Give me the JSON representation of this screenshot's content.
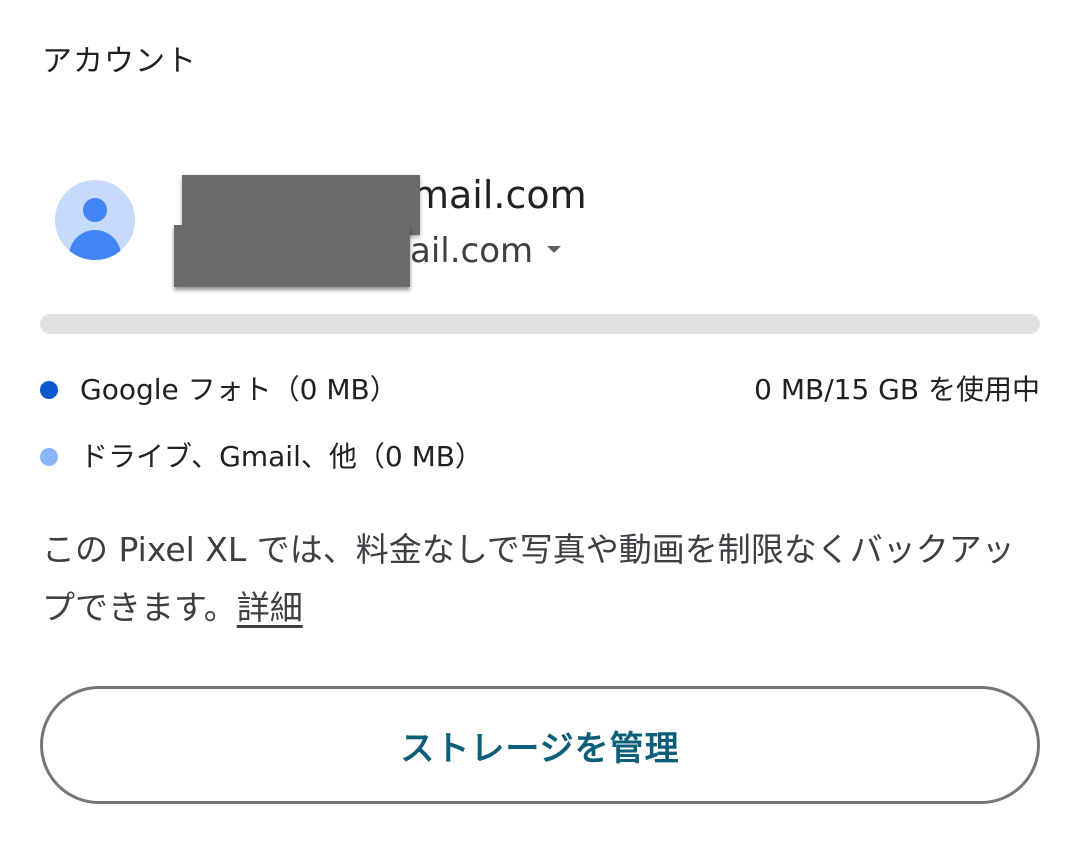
{
  "section": {
    "title": "アカウント"
  },
  "account": {
    "primary_email": "mail.com",
    "secondary_email": "ail.com"
  },
  "storage": {
    "used_fraction": 0,
    "total_label": "0 MB/15 GB を使用中",
    "legend": [
      {
        "label": "Google フォト（0 MB）",
        "color": "#0b57d0"
      },
      {
        "label": "ドライブ、Gmail、他（0 MB）",
        "color": "#8ab4f8"
      }
    ]
  },
  "info": {
    "text": "この Pixel XL では、料金なしで写真や動画を制限なくバックアップできます。",
    "link_label": "詳細"
  },
  "actions": {
    "manage_storage_label": "ストレージを管理"
  },
  "colors": {
    "accent": "#0b5f79",
    "bar_track": "#e0e0e0",
    "avatar_bg": "#c6dafc",
    "avatar_fg": "#4285f4"
  }
}
